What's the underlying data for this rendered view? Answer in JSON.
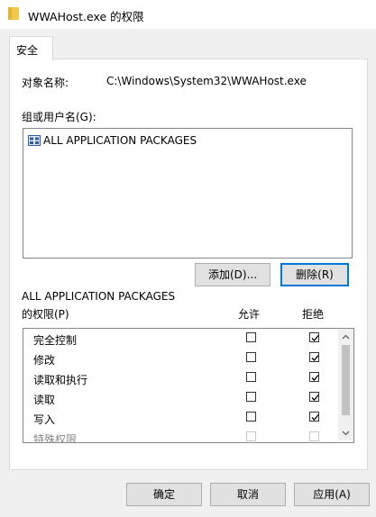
{
  "window": {
    "title": "WWAHost.exe 的权限",
    "folder_icon_color": "#f3c74a"
  },
  "tabs": [
    {
      "label": "安全"
    }
  ],
  "object": {
    "label": "对象名称:",
    "value": "C:\\Windows\\System32\\WWAHost.exe"
  },
  "groups": {
    "label": "组或用户名(G):",
    "items": [
      {
        "name": "ALL APPLICATION PACKAGES",
        "icon": "app-package-icon"
      }
    ]
  },
  "buttons": {
    "add": "添加(D)...",
    "remove": "删除(R)",
    "ok": "确定",
    "cancel": "取消",
    "apply": "应用(A)"
  },
  "permissions": {
    "title_line1": "ALL APPLICATION PACKAGES",
    "title_line2": "的权限(P)",
    "allow_header": "允许",
    "deny_header": "拒绝",
    "rows": [
      {
        "name": "完全控制",
        "allow": false,
        "deny": true
      },
      {
        "name": "修改",
        "allow": false,
        "deny": true
      },
      {
        "name": "读取和执行",
        "allow": false,
        "deny": true
      },
      {
        "name": "读取",
        "allow": false,
        "deny": true
      },
      {
        "name": "写入",
        "allow": false,
        "deny": true
      },
      {
        "name": "特殊权限",
        "allow": false,
        "deny": false
      }
    ]
  },
  "colors": {
    "focus_border": "#0078d7",
    "button_face": "#e1e1e1"
  }
}
